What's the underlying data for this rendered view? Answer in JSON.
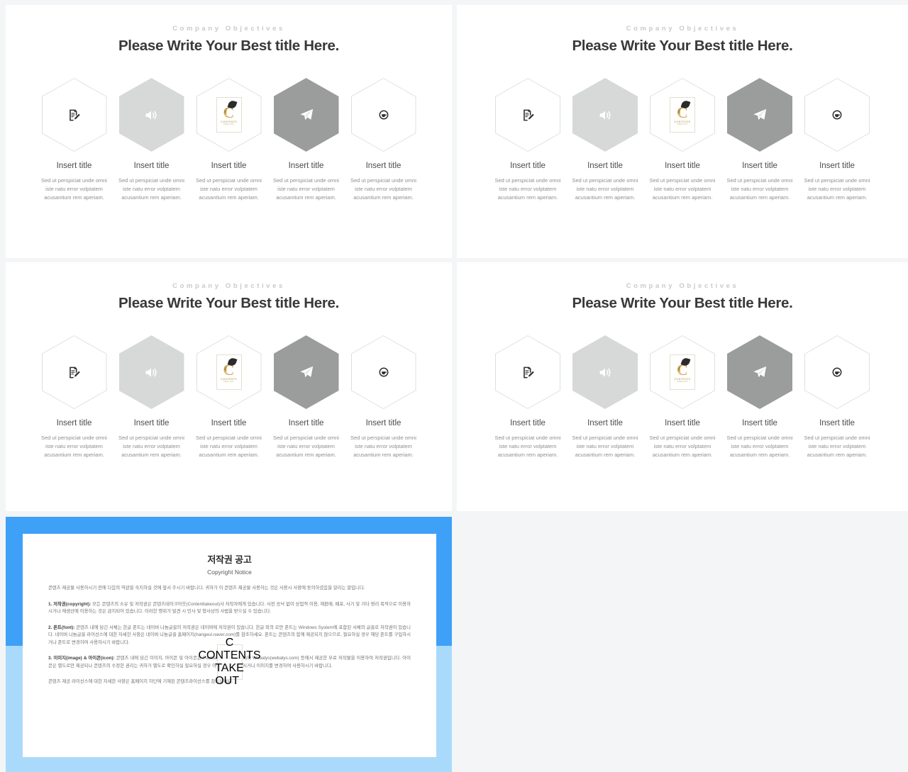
{
  "slides": [
    {
      "id": "slide-top-left",
      "eyebrow": "Company Objectives",
      "headline": "Please Write Your Best title Here.",
      "cards": [
        {
          "icon": "note-edit-icon",
          "style": "outline",
          "title": "Insert title",
          "body": "Sed ut perspiciat unde omni iste natu error volptatem acusantium rem aperiam."
        },
        {
          "icon": "speaker-icon",
          "style": "fill-light",
          "title": "Insert title",
          "body": "Sed ut perspiciat unde omni iste natu error volptatem acusantium rem aperiam."
        },
        {
          "icon": "watermark-logo",
          "style": "outline",
          "title": "Insert title",
          "body": "Sed ut perspiciat unde omni iste natu error volptatem acusantium rem aperiam."
        },
        {
          "icon": "paper-plane-icon",
          "style": "fill-dark",
          "title": "Insert title",
          "body": "Sed ut perspiciat unde omni iste natu error volptatem acusantium rem aperiam."
        },
        {
          "icon": "coffee-cup-icon",
          "style": "outline",
          "title": "Insert title",
          "body": "Sed ut perspiciat unde omni iste natu error volptatem acusantium rem aperiam."
        }
      ]
    },
    {
      "id": "slide-top-right",
      "eyebrow": "Company Objectives",
      "headline": "Please Write Your Best title Here.",
      "cards": [
        {
          "icon": "note-edit-icon",
          "style": "outline",
          "title": "Insert title",
          "body": "Sed ut perspiciat unde omni iste natu error volptatem acusantium rem aperiam."
        },
        {
          "icon": "speaker-icon",
          "style": "fill-light",
          "title": "Insert title",
          "body": "Sed ut perspiciat unde omni iste natu error volptatem acusantium rem aperiam."
        },
        {
          "icon": "watermark-logo",
          "style": "outline",
          "title": "Insert title",
          "body": "Sed ut perspiciat unde omni iste natu error volptatem acusantium rem aperiam."
        },
        {
          "icon": "paper-plane-icon",
          "style": "fill-dark",
          "title": "Insert title",
          "body": "Sed ut perspiciat unde omni iste natu error volptatem acusantium rem aperiam."
        },
        {
          "icon": "coffee-cup-icon",
          "style": "outline",
          "title": "Insert title",
          "body": "Sed ut perspiciat unde omni iste natu error volptatem acusantium rem aperiam."
        }
      ]
    },
    {
      "id": "slide-bottom-left",
      "eyebrow": "Company Objectives",
      "headline": "Please Write Your Best title Here.",
      "cards": [
        {
          "icon": "note-edit-icon",
          "style": "outline",
          "title": "Insert title",
          "body": "Sed ut perspiciat unde omni iste natu error volptatem acusantium rem aperiam."
        },
        {
          "icon": "speaker-icon",
          "style": "fill-light",
          "title": "Insert title",
          "body": "Sed ut perspiciat unde omni iste natu error volptatem acusantium rem aperiam."
        },
        {
          "icon": "watermark-logo",
          "style": "outline",
          "title": "Insert title",
          "body": "Sed ut perspiciat unde omni iste natu error volptatem acusantium rem aperiam."
        },
        {
          "icon": "paper-plane-icon",
          "style": "fill-dark",
          "title": "Insert title",
          "body": "Sed ut perspiciat unde omni iste natu error volptatem acusantium rem aperiam."
        },
        {
          "icon": "coffee-cup-icon",
          "style": "outline",
          "title": "Insert title",
          "body": "Sed ut perspiciat unde omni iste natu error volptatem acusantium rem aperiam."
        }
      ]
    },
    {
      "id": "slide-bottom-right",
      "eyebrow": "Company Objectives",
      "headline": "Please Write Your Best title Here.",
      "cards": [
        {
          "icon": "note-edit-icon",
          "style": "outline",
          "title": "Insert title",
          "body": "Sed ut perspiciat unde omni iste natu error volptatem acusantium rem aperiam."
        },
        {
          "icon": "speaker-icon",
          "style": "fill-light",
          "title": "Insert title",
          "body": "Sed ut perspiciat unde omni iste natu error volptatem acusantium rem aperiam."
        },
        {
          "icon": "watermark-logo",
          "style": "outline",
          "title": "Insert title",
          "body": "Sed ut perspiciat unde omni iste natu error volptatem acusantium rem aperiam."
        },
        {
          "icon": "paper-plane-icon",
          "style": "fill-dark",
          "title": "Insert title",
          "body": "Sed ut perspiciat unde omni iste natu error volptatem acusantium rem aperiam."
        },
        {
          "icon": "coffee-cup-icon",
          "style": "outline",
          "title": "Insert title",
          "body": "Sed ut perspiciat unde omni iste natu error volptatem acusantium rem aperiam."
        }
      ]
    }
  ],
  "copyright": {
    "title": "저작권 공고",
    "subtitle": "Copyright Notice",
    "intro": "콘텐츠 제공물 사용하시기 전에 다음의 약관을 숙지하실 것에 앞서 주시기 바랍니다. 귀하가 이 콘텐츠 제공물 사용하는 것은 사용시 사항에 동의하셨음을 알리는 말입니다.",
    "sections": [
      {
        "label": "1. 저작권(copyright):",
        "text": " 모든 콘텐츠의 소유 및 저작권은 콘텐츠테이크아웃(Contenttakeout)사 저작자에게 있습니다. 사전 승낙 없이 상업적 이용, 재판매, 배포, 사기 및 기타 영리 목적으로 이용하시거나 재생산에 이용하는 것은 금지되어 있습니다. 이러한 행위가 발견 시 민사 및 형사상의 사법을 받으실 수 있습니다."
      },
      {
        "label": "2. 폰트(font):",
        "text": " 콘텐츠 내에 담긴 서체는 한글 폰트는 네이버 나눔글꼴의 저작권은 네이버에 저작권이 있습니다. 한글 외의 로만 폰트는 Windows System에 포함된 서체의 글꼴로 저작권이 있습니다. 네이버 나눔글꼴 라이선스에 대한 자세한 사항은 네이버 나눔글꼴 홈페이지(hangeul.naver.com)를 참조하세요. 폰트는 콘텐츠의 함께 제공되지 않으므로, 필요하실 경우 해당 폰트를 구입하시거나 폰트로 변경하여 사용하시기 바랍니다."
      },
      {
        "label": "3. 이미지(image) & 아이콘(icon):",
        "text": " 콘텐츠 내에 담긴 이미지, 아이콘 및 아이콘은 Pixabay(pixabay.com)와 Webalys(webalys.com) 등에서 제공한 무료 저작물을 이용하여 저작권입니다. 아이콘은 별도로만 제공되나 콘텐츠의 수정한 권리는 귀하가 별도로 확인하실 필요하실 경우 아이콘을 유료하시거나 이미지를 변경하여 사용하시기 바랍니다."
      }
    ],
    "footer": "콘텐츠 제공 라이선스에 대한 자세한 사항은 홈페이지 하단에 기재된 콘텐츠라이선스를 참조하세요.",
    "watermark": {
      "letter": "C",
      "line1": "CONTENTS",
      "line2": "TAKE   OUT"
    }
  },
  "colors": {
    "page_background": "#f4f5f6",
    "slide_background": "#ffffff",
    "eyebrow": "#c9cacc",
    "headline": "#39393b",
    "hex_outline": "#dedfe1",
    "hex_light": "#d7d8d8",
    "hex_dark": "#9b9c9c",
    "copyright_frame_top": "#3fa0f7",
    "copyright_frame_bottom": "#aadafb",
    "body_text": "#8e8f91",
    "logo_gold": "#b8893a"
  }
}
